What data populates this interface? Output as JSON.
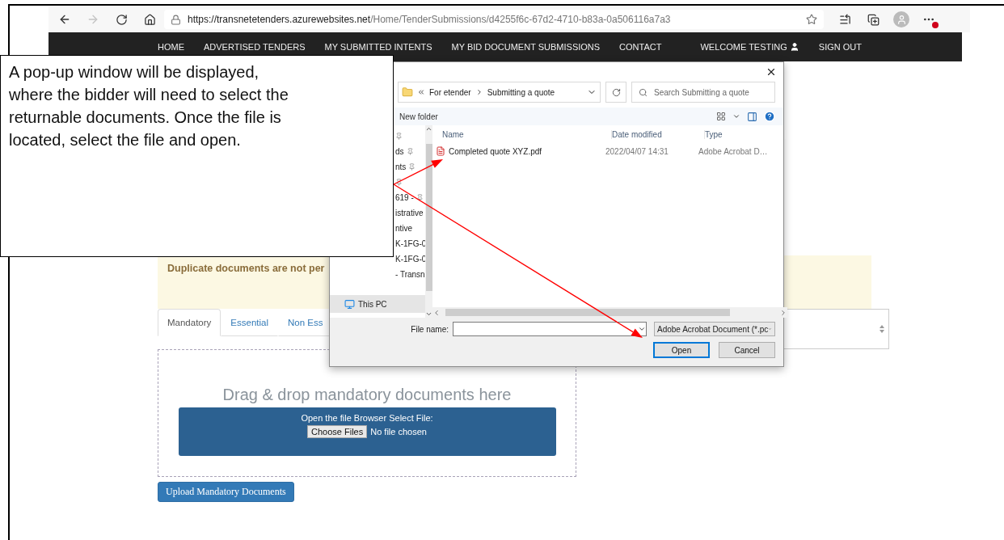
{
  "browser": {
    "url_host": "https://transnetetenders.azurewebsites.net",
    "url_path": "/Home/TenderSubmissions/d4255f6c-67d2-4710-b83a-0a506116a7a3",
    "forward_disabled": true
  },
  "nav": {
    "items": [
      "HOME",
      "ADVERTISED TENDERS",
      "MY SUBMITTED INTENTS",
      "MY BID DOCUMENT SUBMISSIONS",
      "CONTACT"
    ],
    "welcome": "WELCOME TESTING",
    "sign_out": "SIGN OUT"
  },
  "notice": {
    "text": "Duplicate documents are not per"
  },
  "tabs": [
    {
      "label": "Mandatory",
      "selected": true
    },
    {
      "label": "Essential",
      "selected": false
    },
    {
      "label": "Non Ess",
      "selected": false
    }
  ],
  "dropzone": {
    "title": "Drag & drop mandatory documents here",
    "prompt": "Open the file Browser Select File:",
    "choose_button": "Choose Files",
    "file_status": "No file chosen"
  },
  "upload_button": "Upload Mandatory Documents",
  "dialog": {
    "breadcrumb": [
      "For etender",
      "Submitting a quote"
    ],
    "search": {
      "placeholder": "Search Submitting a quote"
    },
    "new_folder": "New folder",
    "columns": [
      "Name",
      "Date modified",
      "Type"
    ],
    "sidebar": [
      {
        "pinned": true
      },
      {
        "label": "ds",
        "pinned": true
      },
      {
        "label": "nts",
        "pinned": true
      },
      {
        "pinned": true
      },
      {
        "label": "619 -",
        "pinned": true
      },
      {
        "label": "istrative",
        "pinned": false
      },
      {
        "label": "ntive",
        "pinned": false
      },
      {
        "label": "K-1FG-0",
        "pinned": false
      },
      {
        "label": "K-1FG-0",
        "pinned": false
      },
      {
        "label": "- Transn",
        "pinned": false
      }
    ],
    "this_pc": {
      "label": "This PC",
      "selected": true
    },
    "files": [
      {
        "name": "Completed quote XYZ.pdf",
        "date": "2022/04/07 14:31",
        "type": "Adobe Acrobat D…"
      }
    ],
    "file_name_label": "File name:",
    "filter": "Adobe Acrobat Document (*.pc",
    "buttons": [
      {
        "label": "Open",
        "default": true
      },
      {
        "label": "Cancel",
        "default": false
      }
    ]
  },
  "callout": {
    "lines": [
      "A pop-up window will be displayed,",
      "where the bidder will need to select the",
      "returnable documents. Once the file is",
      "located, select the file and open."
    ]
  }
}
